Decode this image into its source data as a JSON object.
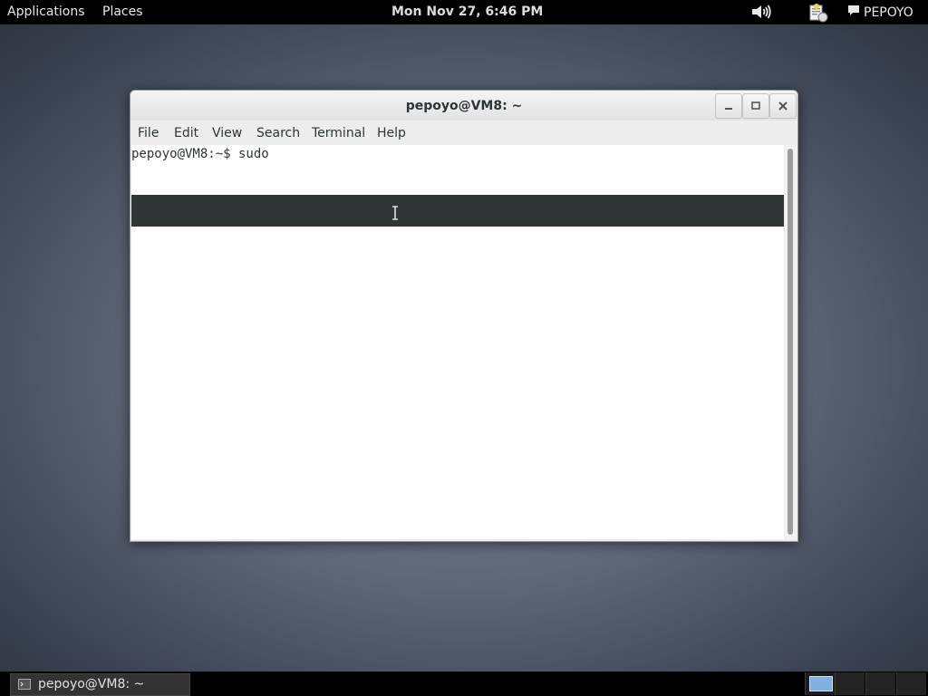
{
  "top_panel": {
    "applications": "Applications",
    "places": "Places",
    "clock": "Mon Nov 27,  6:46 PM",
    "volume_icon": "volume-icon",
    "notification_icon": "notification-icon",
    "user": "PEPOYO"
  },
  "window": {
    "title": "pepoyo@VM8: ~",
    "buttons": {
      "minimize": "minimize-icon",
      "maximize": "maximize-icon",
      "close": "close-icon"
    },
    "menu": [
      "File",
      "Edit",
      "View",
      "Search",
      "Terminal",
      "Help"
    ]
  },
  "terminal": {
    "prompt_line": "pepoyo@VM8:~$ sudo"
  },
  "taskbar": {
    "task_label": "pepoyo@VM8: ~",
    "workspace_count": 4,
    "active_workspace": 1
  },
  "colors": {
    "panel": "#000000",
    "highlight_bar": "#303536",
    "workspace_active": "#7fb2e0"
  }
}
